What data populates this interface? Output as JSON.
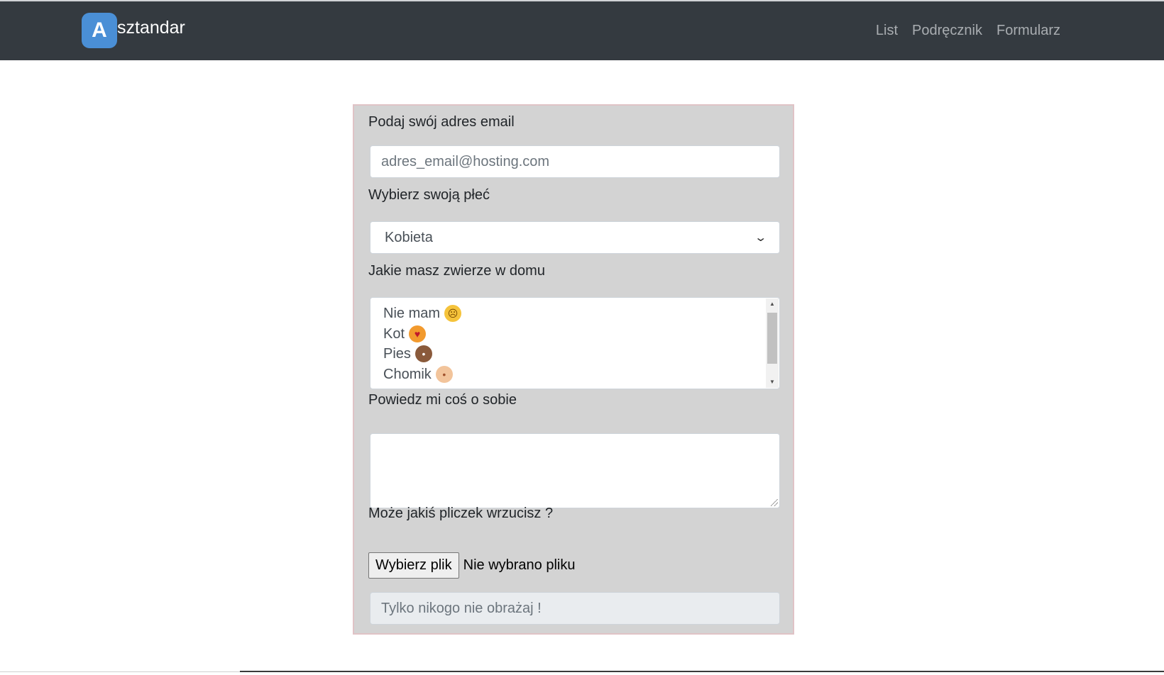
{
  "navbar": {
    "brand_logo_letter": "A",
    "brand_text": "sztandar",
    "links": [
      "List",
      "Podręcznik",
      "Formularz"
    ],
    "colors": {
      "background": "#343a40",
      "logo": "#4a8fd6",
      "link": "#a9adb1"
    }
  },
  "form": {
    "email": {
      "label": "Podaj swój adres email",
      "placeholder": "adres_email@hosting.com",
      "value": ""
    },
    "gender": {
      "label": "Wybierz swoją płeć",
      "selected": "Kobieta"
    },
    "pets": {
      "label": "Jakie masz zwierze w domu",
      "options": [
        {
          "text": "Nie mam",
          "icon": "sad-face-emoji"
        },
        {
          "text": "Kot",
          "icon": "cat-face-emoji"
        },
        {
          "text": "Pies",
          "icon": "dog-face-emoji"
        },
        {
          "text": "Chomik",
          "icon": "hamster-face-emoji"
        }
      ]
    },
    "about": {
      "label": "Powiedz mi coś o sobie",
      "value": ""
    },
    "file": {
      "label": "Może jakiś pliczek wrzucisz ?",
      "button": "Wybierz plik",
      "status": "Nie wybrano pliku"
    },
    "disabled_field": {
      "placeholder": "Tylko nikogo nie obrażaj !"
    },
    "colors": {
      "card_background": "#d3d3d3",
      "card_border": "#e0c3c6"
    }
  }
}
